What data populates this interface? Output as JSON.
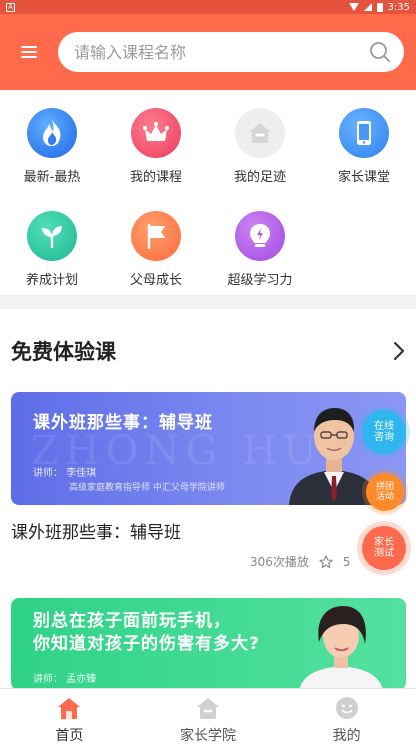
{
  "status_bar": {
    "time": "3:35",
    "app_badge": "A"
  },
  "header": {
    "search_placeholder": "请输入课程名称"
  },
  "categories": [
    {
      "label": "最新-最热",
      "icon": "fire-icon",
      "color": "#2f7ff0"
    },
    {
      "label": "我的课程",
      "icon": "crown-icon",
      "color": "#f2506a"
    },
    {
      "label": "我的足迹",
      "icon": "footprint-house-icon",
      "color": "#eeeeee"
    },
    {
      "label": "家长课堂",
      "icon": "phone-icon",
      "color": "#2e8ef0"
    },
    {
      "label": "养成计划",
      "icon": "sprout-icon",
      "color": "#28c4a0"
    },
    {
      "label": "父母成长",
      "icon": "flag-icon",
      "color": "#ff7a4a"
    },
    {
      "label": "超级学习力",
      "icon": "bulb-icon",
      "color": "#b15be8"
    }
  ],
  "section": {
    "title": "免费体验课"
  },
  "courses": [
    {
      "banner_title": "课外班那些事：辅导班",
      "banner_watermark": "ZHONG HUI",
      "banner_lecturer": "讲师：  李佳琪",
      "banner_credentials": "高级家庭教育指导师    中汇父母学院讲师",
      "title": "课外班那些事：辅导班",
      "plays": "306次播放",
      "stars": "5"
    },
    {
      "banner_title_line1": "别总在孩子面前玩手机，",
      "banner_title_line2": "你知道对孩子的伤害有多大?",
      "banner_lecturer": "讲师：  孟亦臻"
    }
  ],
  "floating": {
    "consult_line1": "在线",
    "consult_line2": "咨询",
    "group_line1": "拼团",
    "group_line2": "活动",
    "test_line1": "家长",
    "test_line2": "测试"
  },
  "bottom_nav": [
    {
      "label": "首页",
      "icon": "home-icon",
      "active": true
    },
    {
      "label": "家长学院",
      "icon": "academy-icon",
      "active": false
    },
    {
      "label": "我的",
      "icon": "profile-icon",
      "active": false
    }
  ],
  "colors": {
    "accent": "#ff6b4a",
    "status_bar": "#e5533c"
  }
}
